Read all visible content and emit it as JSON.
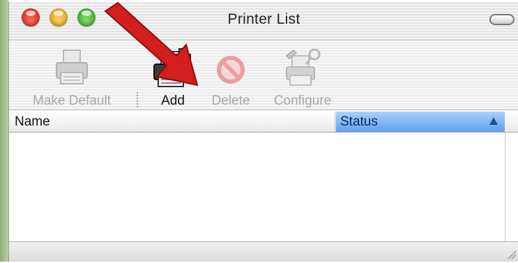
{
  "window": {
    "title": "Printer List"
  },
  "toolbar": {
    "items": [
      {
        "label": "Make Default",
        "icon": "printer-icon",
        "enabled": false
      },
      {
        "label": "Add",
        "icon": "add-printer-icon",
        "enabled": true
      },
      {
        "label": "Delete",
        "icon": "delete-icon",
        "enabled": false
      },
      {
        "label": "Configure",
        "icon": "configure-icon",
        "enabled": false
      }
    ]
  },
  "list": {
    "columns": [
      {
        "label": "Name"
      },
      {
        "label": "Status",
        "sorted": "ascending"
      }
    ],
    "rows": []
  },
  "colors": {
    "annotation_arrow": "#d41e1e",
    "sorted_column": "#7db6f5"
  }
}
